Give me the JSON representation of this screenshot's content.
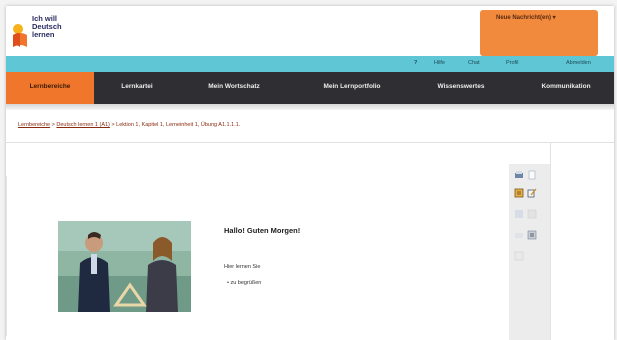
{
  "header": {
    "logo_lines": [
      "Ich will",
      "Deutsch",
      "lernen"
    ],
    "messages_dropdown": "Neue Nachricht(en) ▾"
  },
  "utility_bar": {
    "items": [
      "?",
      "Hilfe",
      "Chat",
      "Profil",
      "Abmelden"
    ]
  },
  "nav": {
    "items": [
      {
        "label": "Lernbereiche",
        "active": true
      },
      {
        "label": "Lernkartei",
        "active": false
      },
      {
        "label": "Mein Wortschatz",
        "active": false
      },
      {
        "label": "Mein Lernportfolio",
        "active": false
      },
      {
        "label": "Wissenswertes",
        "active": false
      },
      {
        "label": "Kommunikation",
        "active": false
      }
    ]
  },
  "breadcrumb": {
    "link1": "Lernbereiche",
    "separator": ">",
    "link2": "Deutsch lernen 1 (A1)",
    "current": "> Lektion 1, Kapitel 1, Lerneinheit 1, Übung A1.1.1.1."
  },
  "content": {
    "headline": "Hallo! Guten Morgen!",
    "intro": "Hier lernen Sie",
    "bullets": [
      "zu begrüßen"
    ]
  },
  "tools": {
    "icons": [
      "print-icon",
      "page-icon",
      "notes-icon",
      "edit-icon",
      "back-icon",
      "forward-icon",
      "audio-icon",
      "list-icon",
      "info-icon"
    ]
  },
  "colors": {
    "accent_orange": "#f0762b",
    "teal_bar": "#5fc6d6",
    "nav_dark": "#2f2f33"
  }
}
